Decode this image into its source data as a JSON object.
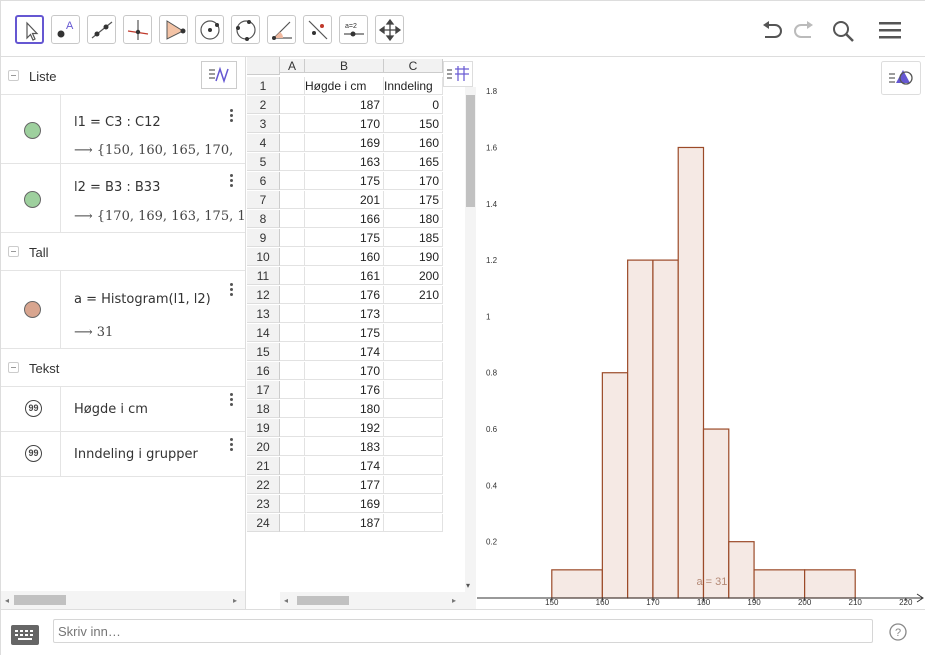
{
  "toolbar": {
    "tools": [
      "move-tool",
      "point-tool",
      "line-tool",
      "perpendicular-line-tool",
      "polygon-tool",
      "circle-center-point-tool",
      "circle-three-points-tool",
      "angle-tool",
      "reflect-about-line-tool",
      "slider-tool",
      "move-graphics-view-tool"
    ],
    "slider_label": "a=2",
    "accent": "#6557d2"
  },
  "algebra": {
    "categories": [
      {
        "label": "Liste"
      },
      {
        "label": "Tall"
      },
      {
        "label": "Tekst"
      }
    ],
    "lists": [
      {
        "definition": "l1 = C3 : C12",
        "output": "⟶  {150, 160, 165, 170,",
        "color": "#9ed09e"
      },
      {
        "definition": "l2 = B3 : B33",
        "output": "⟶  {170, 169, 163, 175, 1",
        "color": "#9ed09e"
      }
    ],
    "numbers": [
      {
        "definition": "a = Histogram(l1, l2)",
        "output": "⟶  31",
        "color": "#d8a58f"
      }
    ],
    "texts": [
      {
        "definition": "Høgde i cm"
      },
      {
        "definition": "Inndeling i grupper"
      }
    ]
  },
  "sheet": {
    "col_headers": [
      "A",
      "B",
      "C"
    ],
    "rows": [
      {
        "n": "1",
        "b": "Høgde i cm",
        "c": "Inndeling"
      },
      {
        "n": "2",
        "b": "187",
        "c": "0"
      },
      {
        "n": "3",
        "b": "170",
        "c": "150"
      },
      {
        "n": "4",
        "b": "169",
        "c": "160"
      },
      {
        "n": "5",
        "b": "163",
        "c": "165"
      },
      {
        "n": "6",
        "b": "175",
        "c": "170"
      },
      {
        "n": "7",
        "b": "201",
        "c": "175"
      },
      {
        "n": "8",
        "b": "166",
        "c": "180"
      },
      {
        "n": "9",
        "b": "175",
        "c": "185"
      },
      {
        "n": "10",
        "b": "160",
        "c": "190"
      },
      {
        "n": "11",
        "b": "161",
        "c": "200"
      },
      {
        "n": "12",
        "b": "176",
        "c": "210"
      },
      {
        "n": "13",
        "b": "173",
        "c": ""
      },
      {
        "n": "14",
        "b": "175",
        "c": ""
      },
      {
        "n": "15",
        "b": "174",
        "c": ""
      },
      {
        "n": "16",
        "b": "170",
        "c": ""
      },
      {
        "n": "17",
        "b": "176",
        "c": ""
      },
      {
        "n": "18",
        "b": "180",
        "c": ""
      },
      {
        "n": "19",
        "b": "192",
        "c": ""
      },
      {
        "n": "20",
        "b": "183",
        "c": ""
      },
      {
        "n": "21",
        "b": "174",
        "c": ""
      },
      {
        "n": "22",
        "b": "177",
        "c": ""
      },
      {
        "n": "23",
        "b": "169",
        "c": ""
      },
      {
        "n": "24",
        "b": "187",
        "c": ""
      }
    ]
  },
  "chart_data": {
    "type": "bar",
    "bins": [
      [
        150,
        160
      ],
      [
        160,
        165
      ],
      [
        165,
        170
      ],
      [
        170,
        175
      ],
      [
        175,
        180
      ],
      [
        180,
        185
      ],
      [
        185,
        190
      ],
      [
        190,
        200
      ],
      [
        200,
        210
      ]
    ],
    "values": [
      0.1,
      0.8,
      1.2,
      1.2,
      1.6,
      0.6,
      0.2,
      0.1,
      0.1
    ],
    "x_ticks": [
      "150",
      "160",
      "170",
      "180",
      "190",
      "200",
      "210",
      "220"
    ],
    "y_ticks": [
      "0.2",
      "0.4",
      "0.6",
      "0.8",
      "1",
      "1.2",
      "1.4",
      "1.6",
      "1.8"
    ],
    "xlim": [
      136,
      224
    ],
    "ylim": [
      0,
      1.9
    ],
    "label": "a = 31",
    "bar_fill": "#f5e9e4",
    "bar_stroke": "#9b4a28"
  },
  "input": {
    "placeholder": "Skriv inn…"
  }
}
